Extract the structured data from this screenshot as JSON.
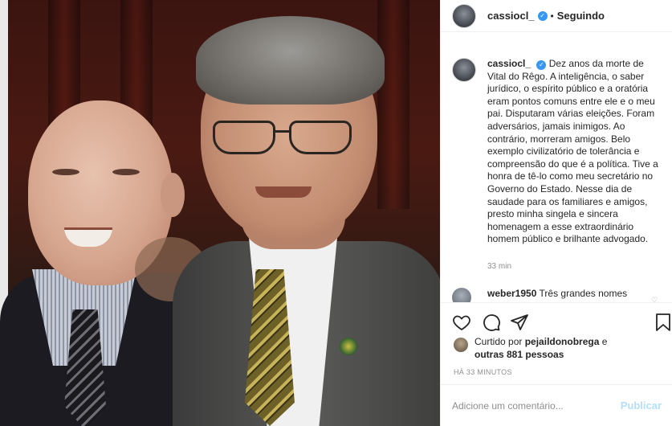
{
  "post": {
    "username": "cassiocl_",
    "following_label": "Seguindo",
    "separator": "•",
    "caption": "Dez anos da morte de Vital do Rêgo. A inteligência, o saber jurídico, o espírito público e a oratória eram pontos comuns entre ele e o meu pai. Disputaram várias eleições. Foram adversários, jamais inimigos. Ao contrário, morreram amigos. Belo exemplo civilizatório de tolerância e compreensão do que é a política. Tive a honra de tê-lo como meu secretário no Governo do Estado. Nesse dia de saudade para os familiares e amigos, presto minha singela e sincera homenagem a esse extraordinário homem público e brilhante advogado.",
    "caption_time": "33 min"
  },
  "comment": {
    "username": "weber1950",
    "text": "Três grandes nomes"
  },
  "likes": {
    "prefix": "Curtido por",
    "user": "pejaildonobrega",
    "joiner": "e",
    "others": "outras 881 pessoas"
  },
  "timestamp": "HÁ 33 MINUTOS",
  "add_comment": {
    "placeholder": "Adicione um comentário...",
    "publish_label": "Publicar"
  },
  "icons": [
    "verified-icon",
    "heart-icon",
    "comment-icon",
    "share-icon",
    "bookmark-icon",
    "comment-like-heart-icon"
  ],
  "colors": {
    "verified": "#3897f0",
    "muted": "#8e8e8e",
    "publish_disabled": "#b2dffc"
  }
}
